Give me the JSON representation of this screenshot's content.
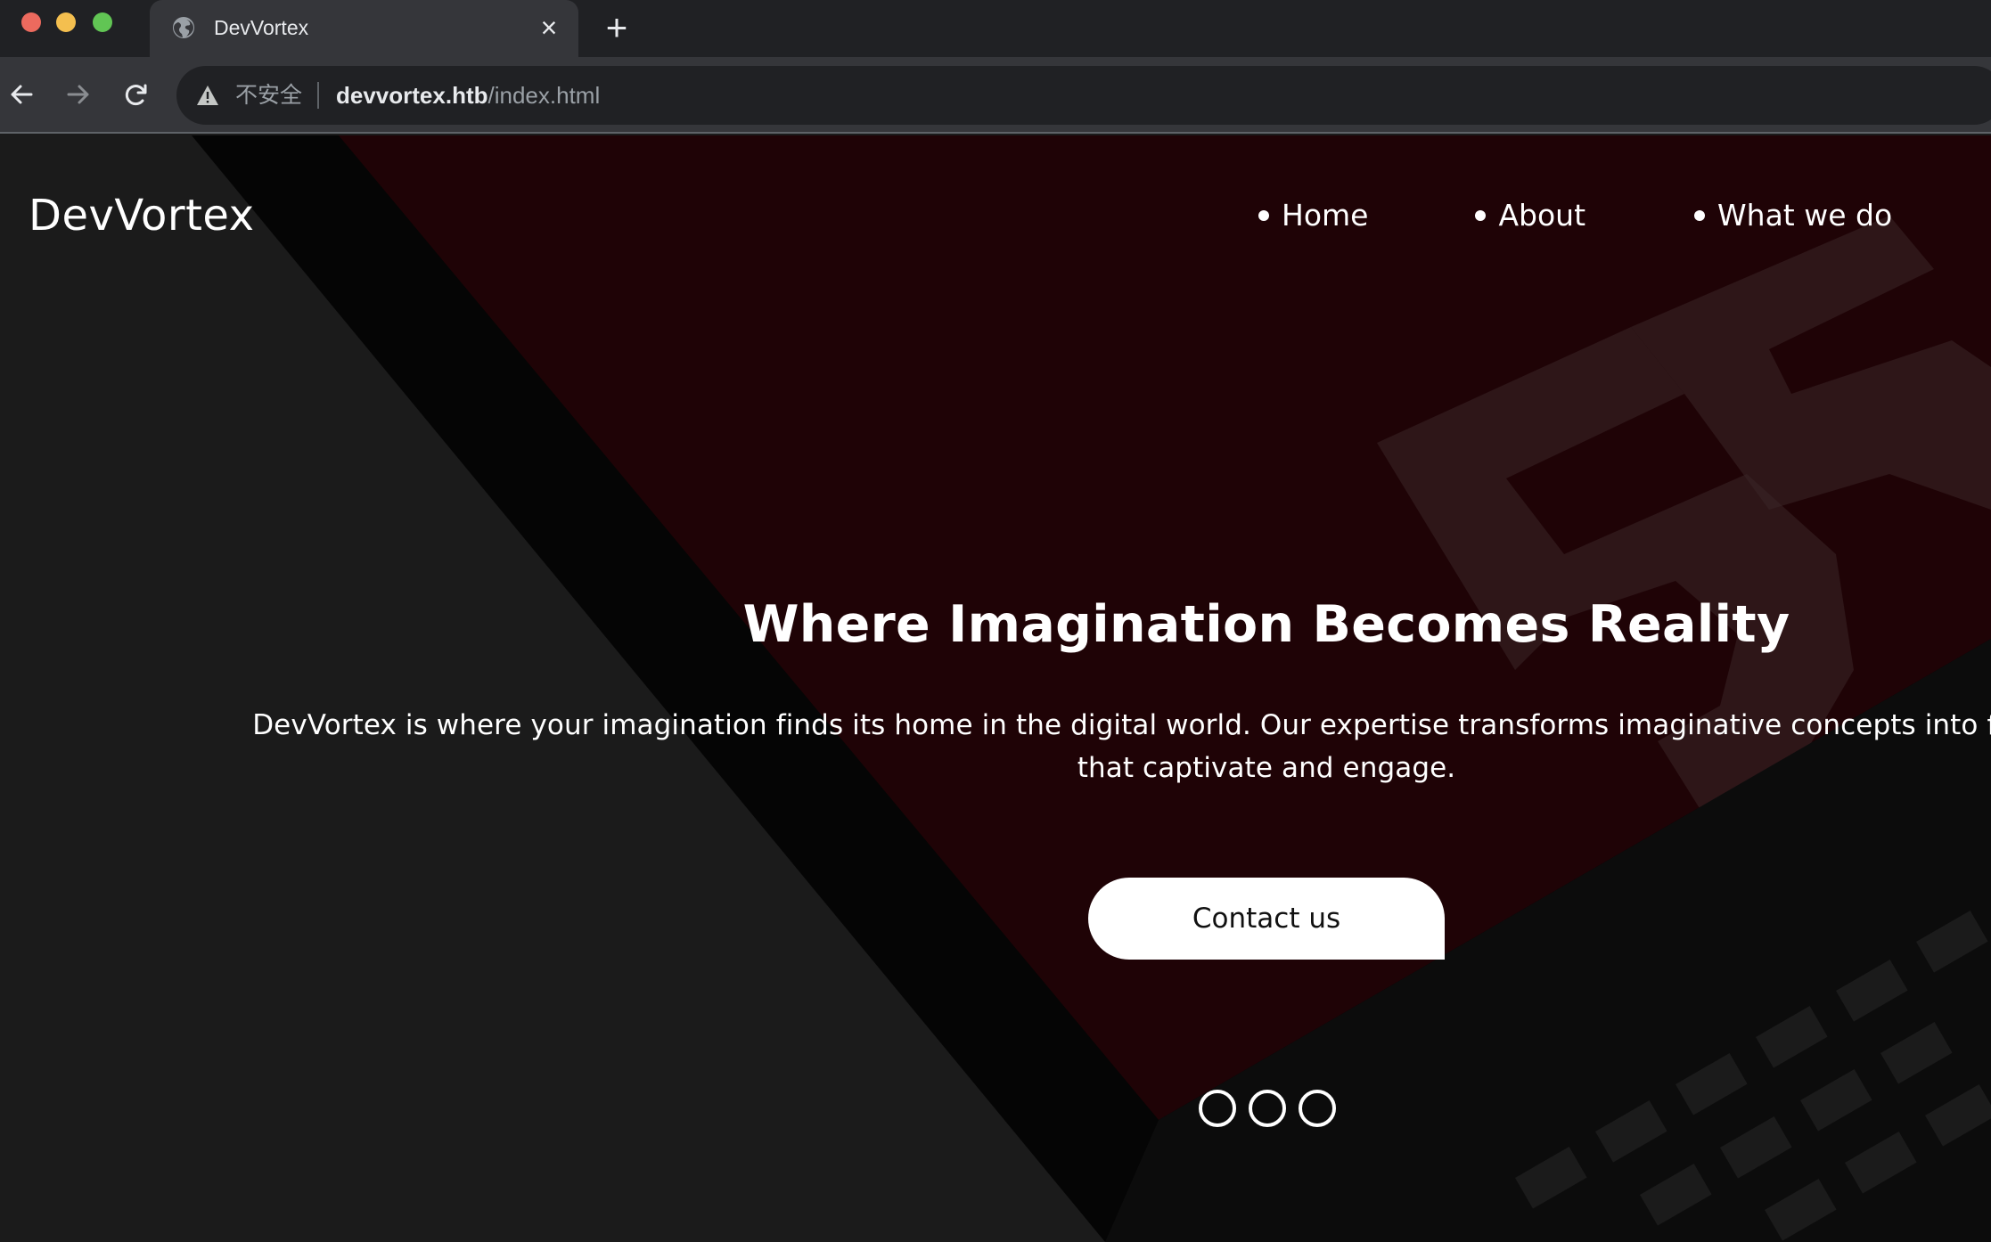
{
  "browser": {
    "tab": {
      "title": "DevVortex",
      "favicon": "globe-icon",
      "close": "×"
    },
    "new_tab": "+",
    "address": {
      "security_label": "不安全",
      "url_host": "devvortex.htb",
      "url_path": "/index.html"
    }
  },
  "site": {
    "brand": "DevVortex",
    "nav": [
      {
        "label": "Home"
      },
      {
        "label": "About"
      },
      {
        "label": "What we do"
      }
    ],
    "hero": {
      "title": "Where Imagination Becomes Reality",
      "text": "DevVortex is where your imagination finds its home in the digital world. Our expertise transforms imaginative concepts into feature-rich websites that captivate and engage.",
      "cta": "Contact us"
    },
    "slides": {
      "count": 3
    }
  },
  "colors": {
    "chrome_dark": "#202124",
    "chrome_mid": "#35363a",
    "page_bg": "#1b1b1b",
    "screen_red": "#1f0306",
    "text": "#ffffff"
  }
}
